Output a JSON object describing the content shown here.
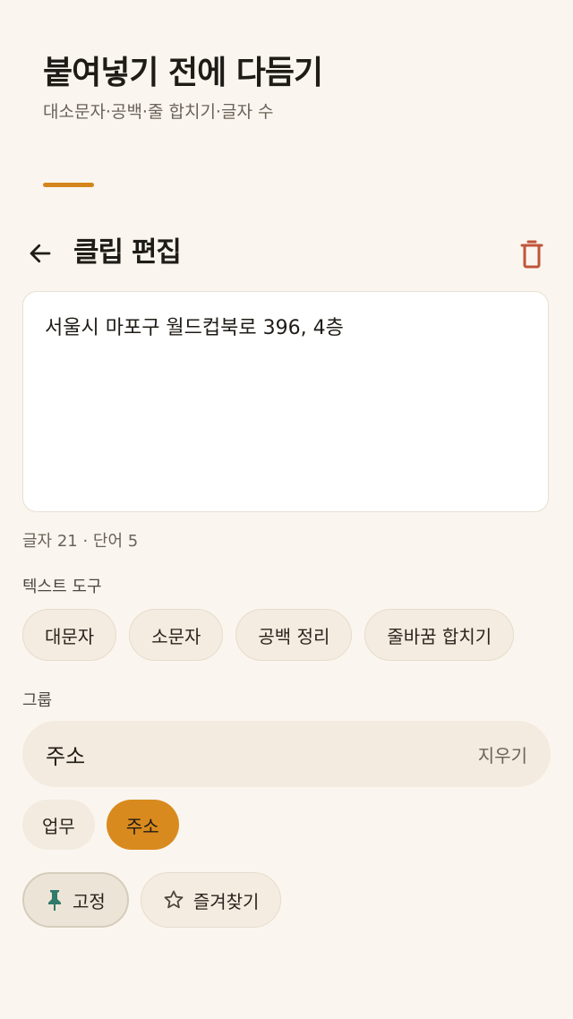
{
  "header": {
    "title": "붙여넣기 전에 다듬기",
    "subtitle": "대소문자·공백·줄 합치기·글자 수",
    "accent_color": "#d4861c"
  },
  "toolbar": {
    "back_icon": "arrow-left-icon",
    "title": "클립 편집",
    "delete_icon": "trash-icon",
    "delete_color": "#c0553a"
  },
  "editor": {
    "text": "서울시 마포구 월드컵북로 396, 4층"
  },
  "counter": "글자 21 · 단어 5",
  "tools": {
    "label": "텍스트 도구",
    "items": [
      "대문자",
      "소문자",
      "공백 정리",
      "줄바꿈 합치기"
    ]
  },
  "group": {
    "label": "그룹",
    "value": "주소",
    "clear_label": "지우기",
    "tags": [
      {
        "label": "업무",
        "selected": false
      },
      {
        "label": "주소",
        "selected": true
      }
    ]
  },
  "actions": {
    "pin_label": "고정",
    "pin_icon": "pin-icon",
    "pin_color": "#2f7a6b",
    "favorite_label": "즐겨찾기",
    "favorite_icon": "star-outline-icon"
  }
}
